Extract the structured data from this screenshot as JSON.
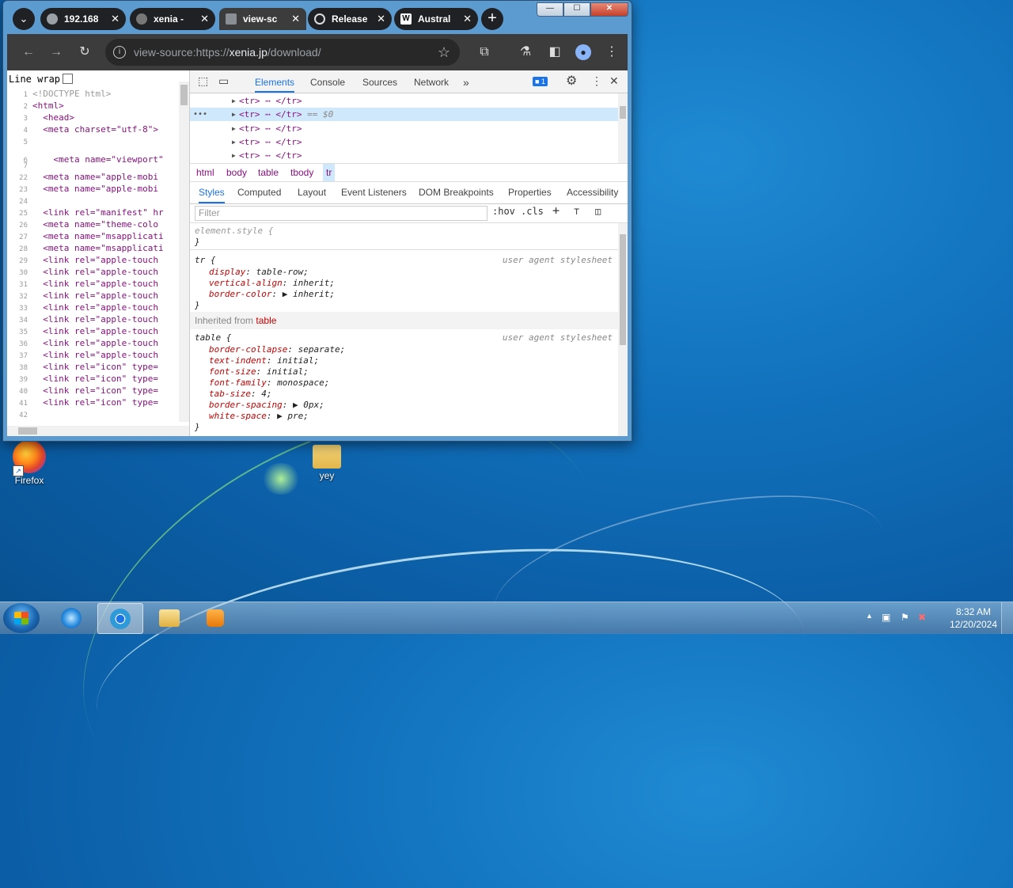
{
  "window_controls": {
    "minimize": "—",
    "maximize": "☐",
    "close": "✕"
  },
  "tabs": [
    {
      "title": "192.168",
      "icon": "globe-icon"
    },
    {
      "title": "xenia -",
      "icon": "xenia-icon"
    },
    {
      "title": "view-sc",
      "icon": "xenia-icon",
      "active": true
    },
    {
      "title": "Release",
      "icon": "github-icon"
    },
    {
      "title": "Austral",
      "icon": "wikipedia-icon"
    }
  ],
  "tab_close": "✕",
  "new_tab": "+",
  "address": {
    "prefix": "view-source:https://",
    "host": "xenia.jp",
    "path": "/download/"
  },
  "source": {
    "line_wrap_label": "Line wrap",
    "lines": [
      {
        "n": "1",
        "code": "<!DOCTYPE html>"
      },
      {
        "n": "2",
        "code": "<html>"
      },
      {
        "n": "3",
        "code": "  <head>"
      },
      {
        "n": "4",
        "code": "  <meta charset=\"utf-8\">"
      },
      {
        "n": "5",
        "code": ""
      },
      {
        "n": "6",
        "code": "    <meta name=\"viewport\""
      },
      {
        "n": "7",
        "code": ""
      },
      {
        "n": "22",
        "code": "  <meta name=\"apple-mobi"
      },
      {
        "n": "23",
        "code": "  <meta name=\"apple-mobi"
      },
      {
        "n": "24",
        "code": ""
      },
      {
        "n": "25",
        "code": "  <link rel=\"manifest\" hr"
      },
      {
        "n": "26",
        "code": "  <meta name=\"theme-colo"
      },
      {
        "n": "27",
        "code": "  <meta name=\"msapplicati"
      },
      {
        "n": "28",
        "code": "  <meta name=\"msapplicati"
      },
      {
        "n": "29",
        "code": "  <link rel=\"apple-touch"
      },
      {
        "n": "30",
        "code": "  <link rel=\"apple-touch"
      },
      {
        "n": "31",
        "code": "  <link rel=\"apple-touch"
      },
      {
        "n": "32",
        "code": "  <link rel=\"apple-touch"
      },
      {
        "n": "33",
        "code": "  <link rel=\"apple-touch"
      },
      {
        "n": "34",
        "code": "  <link rel=\"apple-touch"
      },
      {
        "n": "35",
        "code": "  <link rel=\"apple-touch"
      },
      {
        "n": "36",
        "code": "  <link rel=\"apple-touch"
      },
      {
        "n": "37",
        "code": "  <link rel=\"apple-touch"
      },
      {
        "n": "38",
        "code": "  <link rel=\"icon\" type="
      },
      {
        "n": "39",
        "code": "  <link rel=\"icon\" type="
      },
      {
        "n": "40",
        "code": "  <link rel=\"icon\" type="
      },
      {
        "n": "41",
        "code": "  <link rel=\"icon\" type="
      },
      {
        "n": "42",
        "code": ""
      }
    ]
  },
  "devtools": {
    "tabs": [
      "Elements",
      "Console",
      "Sources",
      "Network"
    ],
    "more_tabs": "»",
    "issues_count": "1",
    "dom_rows": [
      {
        "text": "<tr> ⋯ </tr>",
        "selected": false
      },
      {
        "text": "<tr> ⋯ </tr>",
        "selected": true,
        "suffix": "== $0"
      },
      {
        "text": "<tr> ⋯ </tr>",
        "selected": false
      },
      {
        "text": "<tr> ⋯ </tr>",
        "selected": false
      },
      {
        "text": "<tr> ⋯ </tr>",
        "selected": false
      }
    ],
    "breadcrumbs": [
      "html",
      "body",
      "table",
      "tbody",
      "tr"
    ],
    "sub_tabs": [
      "Styles",
      "Computed",
      "Layout",
      "Event Listeners",
      "DOM Breakpoints",
      "Properties",
      "Accessibility"
    ],
    "filter_placeholder": "Filter",
    "hov": ":hov",
    "cls": ".cls",
    "element_style": "element.style {",
    "close_brace": "}",
    "tr_rule": {
      "selector": "tr {",
      "source": "user agent stylesheet",
      "props": [
        {
          "name": "display",
          "value": "table-row;"
        },
        {
          "name": "vertical-align",
          "value": "inherit;"
        },
        {
          "name": "border-color",
          "value": "▶ inherit;"
        }
      ]
    },
    "inherited_label": "Inherited from",
    "inherited_tag": "table",
    "table_rule": {
      "selector": "table {",
      "source": "user agent stylesheet",
      "props": [
        {
          "name": "border-collapse",
          "value": "separate;"
        },
        {
          "name": "text-indent",
          "value": "initial;"
        },
        {
          "name": "font-size",
          "value": "initial;"
        },
        {
          "name": "font-family",
          "value": "monospace;"
        },
        {
          "name": "tab-size",
          "value": "4;"
        },
        {
          "name": "border-spacing",
          "value": "▶ 0px;"
        },
        {
          "name": "white-space",
          "value": "▶ pre;"
        }
      ]
    }
  },
  "desktop_icons": [
    {
      "label": "Firefox",
      "icon": "firefox-icon"
    },
    {
      "label": "yey",
      "icon": "folder-icon"
    }
  ],
  "taskbar": {
    "apps": [
      "internet-explorer-icon",
      "chromium-icon",
      "file-explorer-icon",
      "media-player-icon"
    ],
    "time": "8:32 AM",
    "date": "12/20/2024"
  }
}
